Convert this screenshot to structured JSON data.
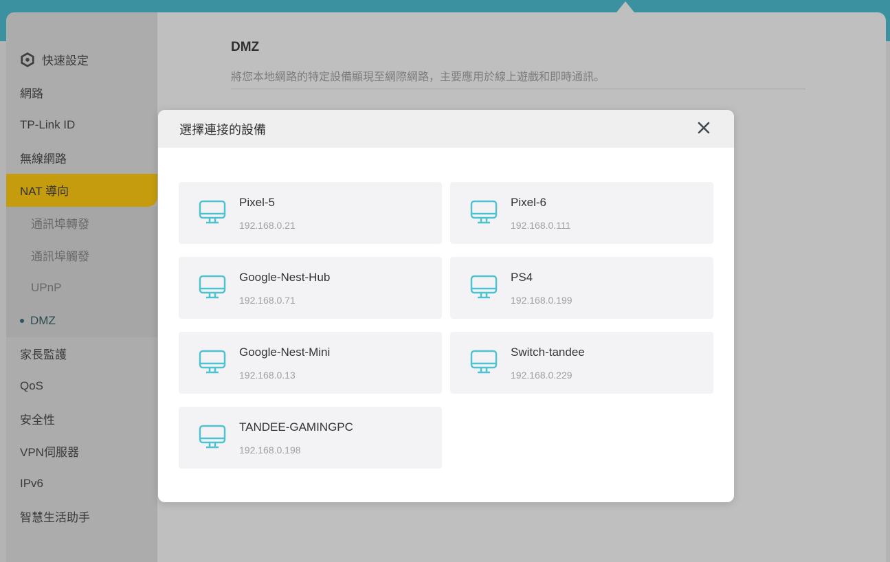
{
  "sidebar": {
    "items": [
      {
        "label": "快速設定",
        "icon": "gear-icon"
      },
      {
        "label": "網路"
      },
      {
        "label": "TP-Link ID"
      },
      {
        "label": "無線網路"
      },
      {
        "label": "NAT 導向",
        "active": true
      },
      {
        "label": "通訊埠轉發"
      },
      {
        "label": "通訊埠觸發"
      },
      {
        "label": "UPnP"
      },
      {
        "label": "DMZ",
        "current": true
      },
      {
        "label": "家長監護"
      },
      {
        "label": "QoS"
      },
      {
        "label": "安全性"
      },
      {
        "label": "VPN伺服器"
      },
      {
        "label": "IPv6"
      },
      {
        "label": "智慧生活助手"
      }
    ]
  },
  "content": {
    "title": "DMZ",
    "description": "將您本地網路的特定設備顯現至網際網路，主要應用於線上遊戲和即時通訊。"
  },
  "modal": {
    "title": "選擇連接的設備",
    "devices": [
      {
        "name": "Pixel-5",
        "ip": "192.168.0.21"
      },
      {
        "name": "Pixel-6",
        "ip": "192.168.0.111"
      },
      {
        "name": "Google-Nest-Hub",
        "ip": "192.168.0.71"
      },
      {
        "name": "PS4",
        "ip": "192.168.0.199"
      },
      {
        "name": "Google-Nest-Mini",
        "ip": "192.168.0.13"
      },
      {
        "name": "Switch-tandee",
        "ip": "192.168.0.229"
      },
      {
        "name": "TANDEE-GAMINGPC",
        "ip": "192.168.0.198"
      }
    ]
  },
  "colors": {
    "accent": "#4ec3cf",
    "active_nav": "#c49c0e",
    "topbar": "#3b919f"
  }
}
